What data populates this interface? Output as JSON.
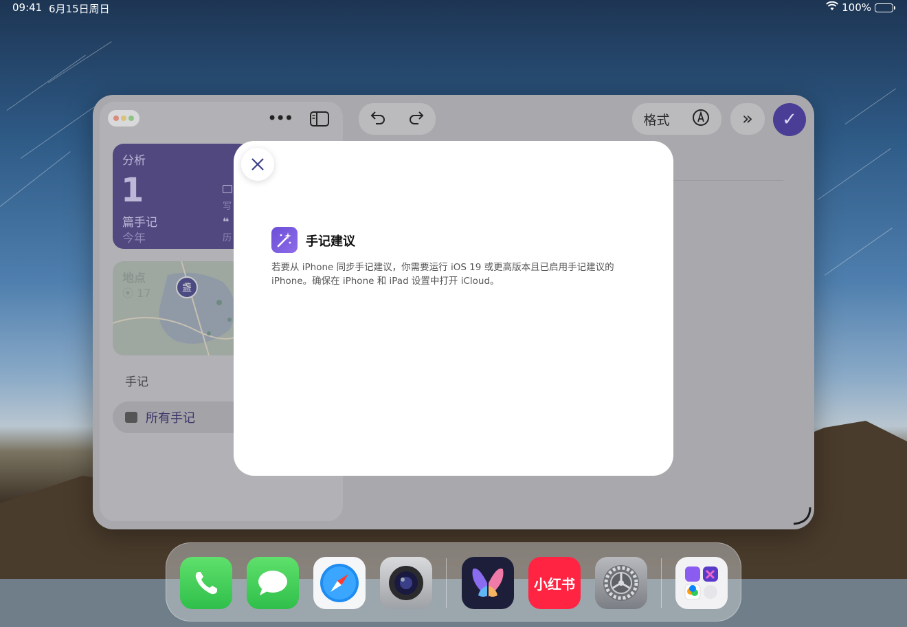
{
  "status_bar": {
    "time": "09:41",
    "date": "6月15日周日",
    "battery": "100%"
  },
  "toolbar": {
    "format_label": "格式"
  },
  "sidebar": {
    "analysis_title": "分析",
    "analysis_count": "1",
    "analysis_unit": "篇手记",
    "analysis_period": "今年",
    "analysis_side_1": "写",
    "analysis_side_2": "历",
    "map_title": "地点",
    "map_count": "17",
    "map_pin_label": "盏",
    "section_label": "手记",
    "all_notes_label": "所有手记"
  },
  "modal": {
    "title": "手记建议",
    "body": "若要从 iPhone 同步手记建议，你需要运行 iOS 19 或更高版本且已启用手记建议的 iPhone。确保在 iPhone 和 iPad 设置中打开 iCloud。"
  },
  "dock": {
    "apps": [
      "phone-app",
      "messages-app",
      "safari-app",
      "camera-app",
      "journal-app",
      "xiaohongshu-app",
      "settings-app",
      "folder-app"
    ],
    "xiaohongshu_label": "小红书"
  },
  "colors": {
    "accent": "#4a3d96",
    "modal_icon": "#6b4fd8",
    "phone_green": "#34c759",
    "xhs_red": "#ff2442"
  }
}
